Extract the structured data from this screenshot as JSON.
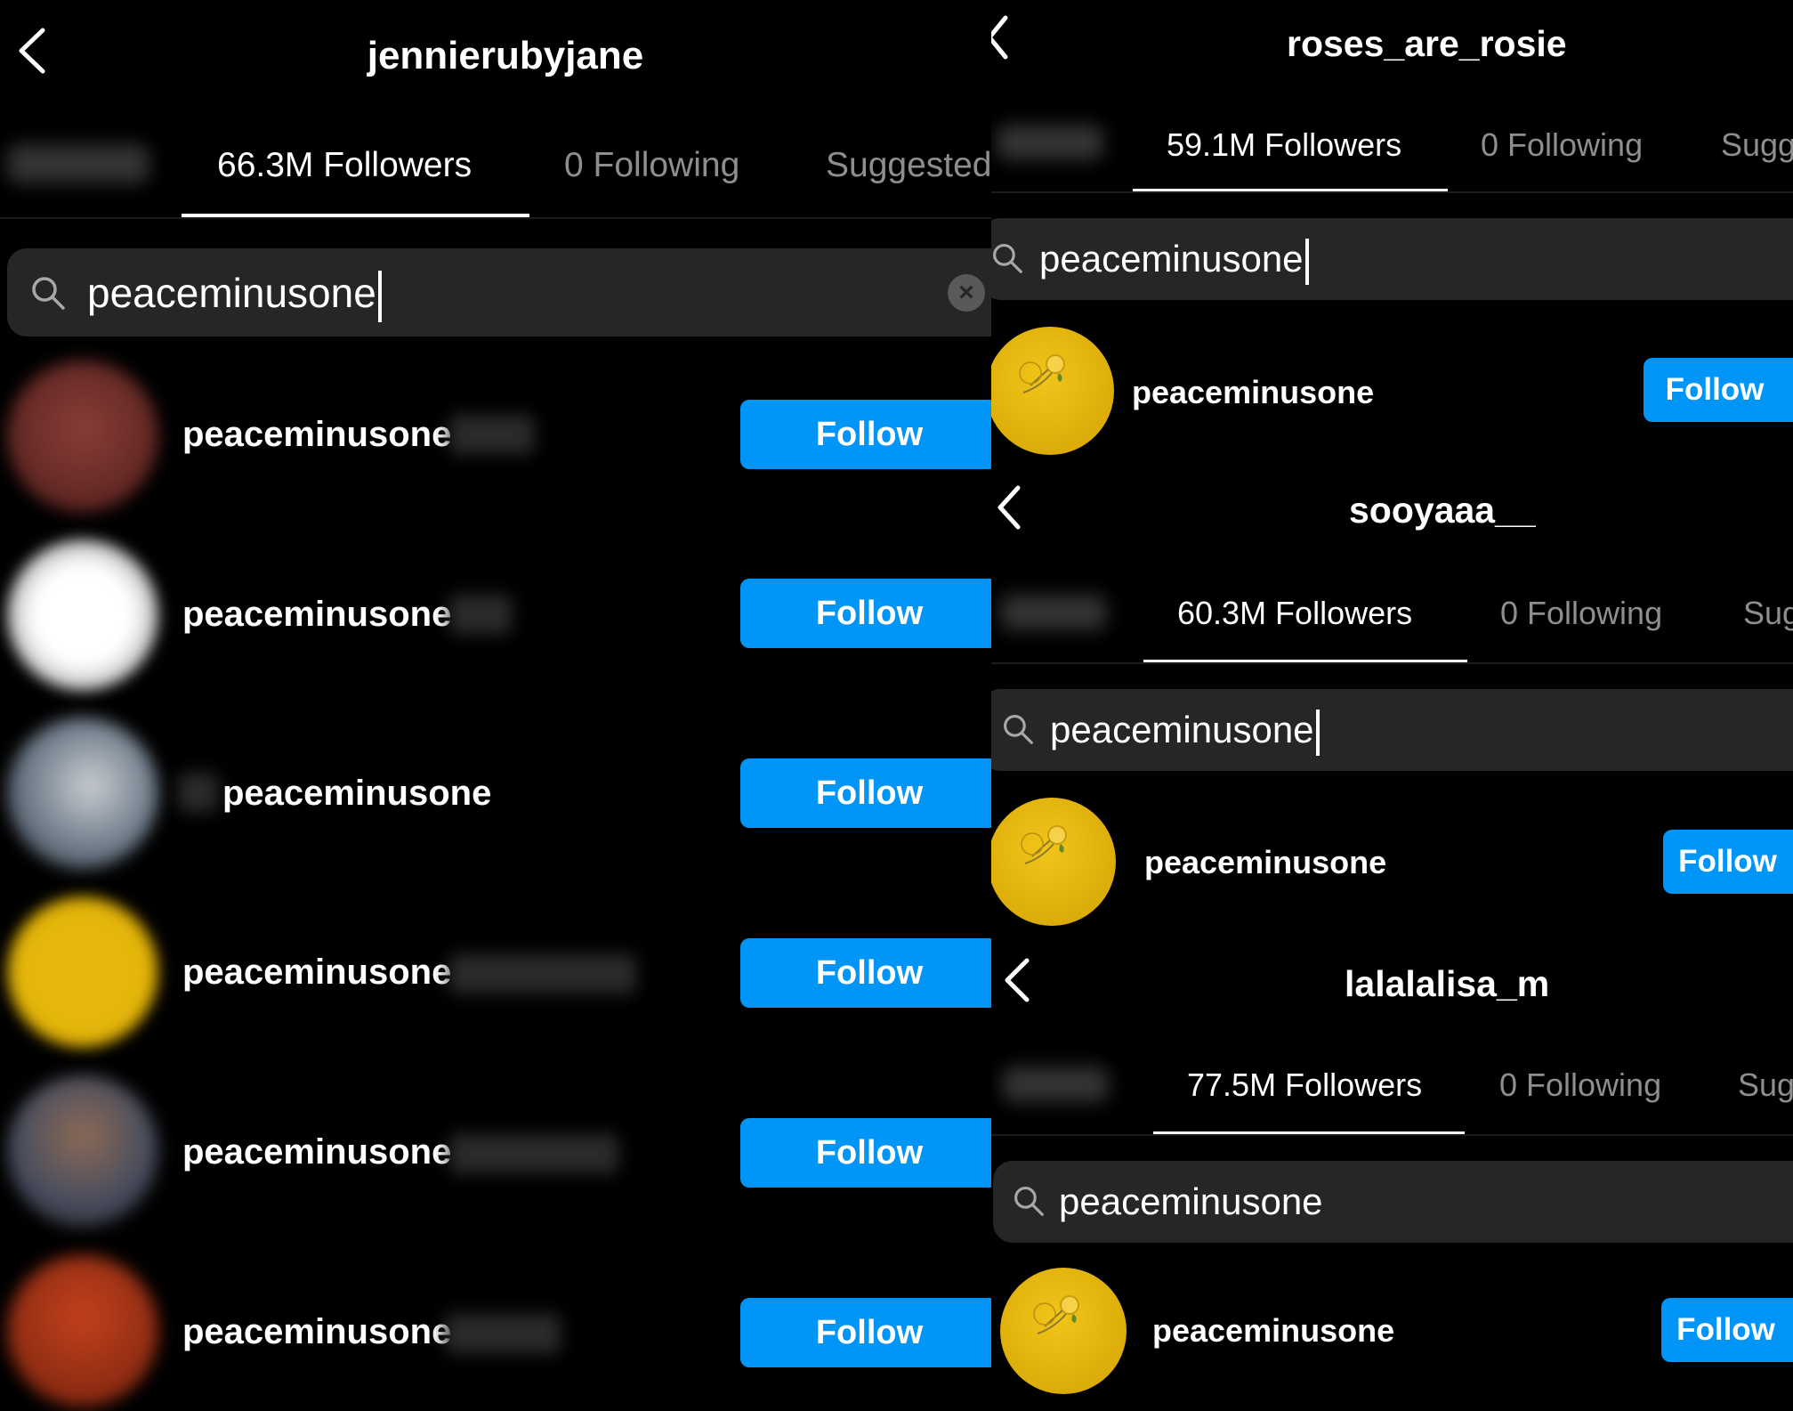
{
  "left": {
    "title": "jennierubyjane",
    "tabs": {
      "followers": "66.3M Followers",
      "following": "0 Following",
      "suggested": "Suggested"
    },
    "search": {
      "value": "peaceminusone"
    },
    "results": [
      {
        "username": "peaceminusone",
        "follow_label": "Follow"
      },
      {
        "username": "peaceminusone",
        "follow_label": "Follow"
      },
      {
        "username": "peaceminusone",
        "follow_label": "Follow"
      },
      {
        "username": "peaceminusone",
        "follow_label": "Follow"
      },
      {
        "username": "peaceminusone",
        "follow_label": "Follow"
      },
      {
        "username": "peaceminusone",
        "follow_label": "Follow"
      }
    ]
  },
  "rosie": {
    "title": "roses_are_rosie",
    "tabs": {
      "followers": "59.1M Followers",
      "following": "0 Following",
      "suggested": "Sugg"
    },
    "search": {
      "value": "peaceminusone"
    },
    "result": {
      "username": "peaceminusone",
      "follow_label": "Follow"
    }
  },
  "jisoo": {
    "title": "sooyaaa__",
    "tabs": {
      "followers": "60.3M Followers",
      "following": "0 Following",
      "suggested": "Sug"
    },
    "search": {
      "value": "peaceminusone"
    },
    "result": {
      "username": "peaceminusone",
      "follow_label": "Follow"
    }
  },
  "lisa": {
    "title": "lalalalisa_m",
    "tabs": {
      "followers": "77.5M Followers",
      "following": "0 Following",
      "suggested": "Sug"
    },
    "search": {
      "value": "peaceminusone"
    },
    "result": {
      "username": "peaceminusone",
      "follow_label": "Follow"
    }
  },
  "colors": {
    "background": "#000000",
    "follow_button": "#0095f6",
    "search_bar": "#262626",
    "inactive_tab": "#8e8e8e",
    "avatar_yellow": "#e8b90c"
  },
  "icons": [
    "chevron-left-icon",
    "search-icon",
    "clear-icon"
  ]
}
